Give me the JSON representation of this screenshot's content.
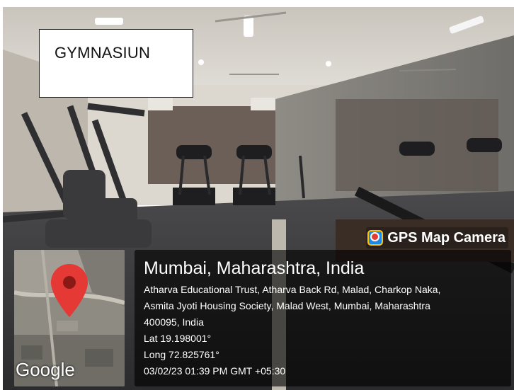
{
  "overlay_label": {
    "text": "GYMNASIUN"
  },
  "watermark": {
    "text": "GPS Map Camera",
    "icon": "gps-map-camera-icon"
  },
  "map_thumbnail": {
    "provider": "Google",
    "pin_icon": "map-pin-icon"
  },
  "location": {
    "title": "Mumbai, Maharashtra, India",
    "address_line_1": "Atharva Educational Trust, Atharva Back Rd, Malad, Charkop Naka,",
    "address_line_2": "Asmita Jyoti Housing Society, Malad West, Mumbai, Maharashtra",
    "address_line_3": "400095, India",
    "latitude": "Lat 19.198001°",
    "longitude": "Long 72.825761°",
    "timestamp": "03/02/23 01:39 PM GMT +05:30"
  },
  "colors": {
    "panel_bg": "#000000",
    "pin": "#e53935",
    "text": "#ffffff"
  }
}
